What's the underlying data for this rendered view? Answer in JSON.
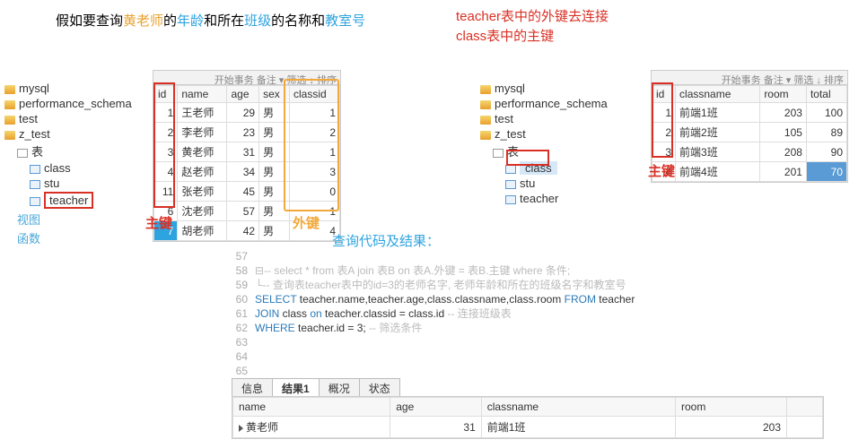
{
  "title1": {
    "p1": "假如要查询",
    "p2": "黄老师",
    "p3": "的",
    "p4": "年龄",
    "p5": "和所在",
    "p6": "班级",
    "p7": "的名称和",
    "p8": "教室号"
  },
  "title2": {
    "l1": "teacher表中的外键去连接",
    "l2": "class表中的主键"
  },
  "tree1": {
    "nodes": [
      "mysql",
      "performance_schema",
      "test",
      "z_test",
      "表",
      "class",
      "stu",
      "teacher",
      "视图",
      "函数"
    ]
  },
  "tree2": {
    "nodes": [
      "mysql",
      "performance_schema",
      "test",
      "z_test",
      "表",
      "class",
      "stu",
      "teacher"
    ]
  },
  "toolbar": "开始事务   备注 ▾ 筛选 ↓ 排序",
  "grid1": {
    "headers": [
      "id",
      "name",
      "age",
      "sex",
      "classid"
    ],
    "rows": [
      [
        "1",
        "王老师",
        "29",
        "男",
        "1"
      ],
      [
        "2",
        "李老师",
        "23",
        "男",
        "2"
      ],
      [
        "3",
        "黄老师",
        "31",
        "男",
        "1"
      ],
      [
        "4",
        "赵老师",
        "34",
        "男",
        "3"
      ],
      [
        "11",
        "张老师",
        "45",
        "男",
        "0"
      ],
      [
        "6",
        "沈老师",
        "57",
        "男",
        "1"
      ],
      [
        "7",
        "胡老师",
        "42",
        "男",
        "4"
      ]
    ]
  },
  "grid2": {
    "headers": [
      "id",
      "classname",
      "room",
      "total"
    ],
    "rows": [
      [
        "1",
        "前端1班",
        "203",
        "100"
      ],
      [
        "2",
        "前端2班",
        "105",
        "89"
      ],
      [
        "3",
        "前端3班",
        "208",
        "90"
      ],
      [
        "4",
        "前端4班",
        "201",
        "70"
      ]
    ]
  },
  "labels": {
    "pk": "主键",
    "fk": "外键"
  },
  "midTitle": "查询代码及结果：",
  "code": {
    "l57": "",
    "l58": "-- select * from 表A join 表B on 表A.外键 = 表B.主键 where 条件;",
    "l59": "-- 查询表teacher表中的id=3的老师名字, 老师年龄和所在的班级名字和教室号",
    "l60a": "SELECT",
    "l60b": " teacher.name,teacher.age,class.classname,class.room ",
    "l60c": "FROM",
    "l60d": " teacher",
    "l61a": "JOIN",
    "l61b": " class ",
    "l61c": "on",
    "l61d": " teacher.classid = class.id ",
    "l61e": "-- 连接班级表",
    "l62a": "WHERE",
    "l62b": " teacher.id = 3; ",
    "l62c": "-- 筛选条件"
  },
  "tabs": [
    "信息",
    "结果1",
    "概况",
    "状态"
  ],
  "result": {
    "headers": [
      "name",
      "age",
      "classname",
      "room"
    ],
    "row": [
      "黄老师",
      "31",
      "前端1班",
      "203"
    ]
  }
}
